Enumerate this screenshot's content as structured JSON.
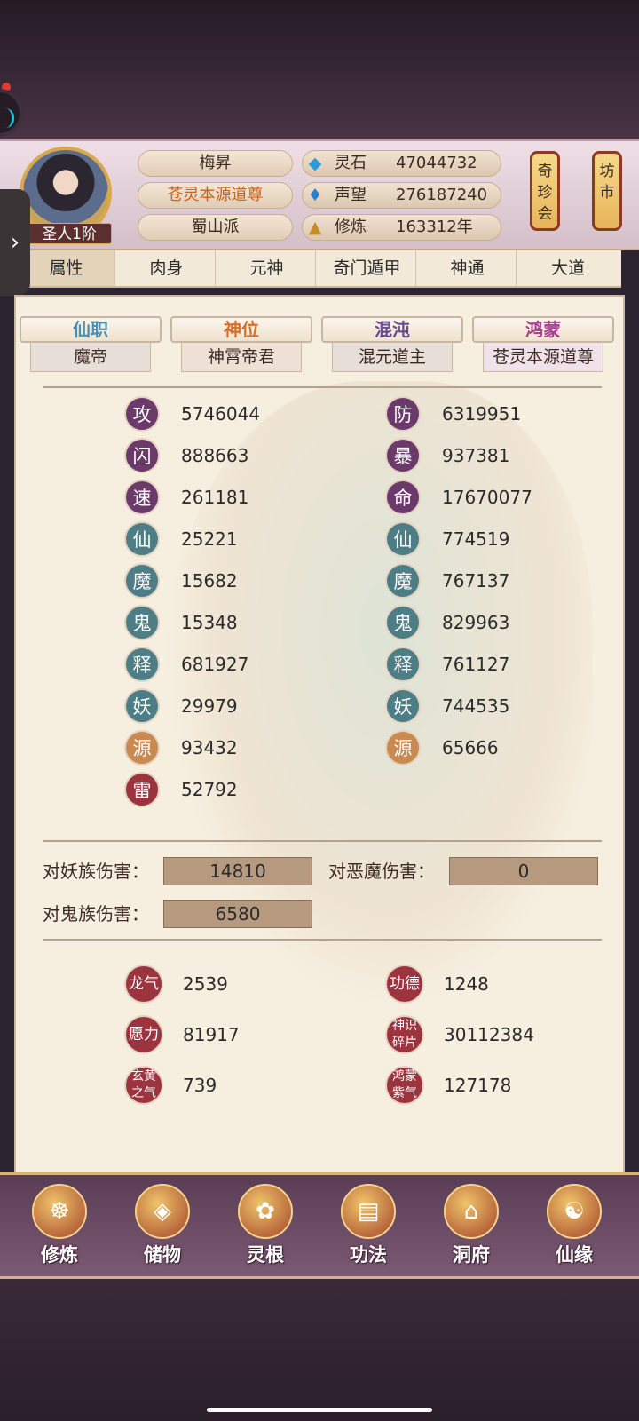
{
  "header": {
    "rank_badge": "圣人1阶",
    "name": "梅昇",
    "title": "苍灵本源道尊",
    "sect": "蜀山派",
    "resources": [
      {
        "icon": "spirit-stone-icon",
        "label": "灵石",
        "value": "47044732"
      },
      {
        "icon": "prestige-icon",
        "label": "声望",
        "value": "276187240"
      },
      {
        "icon": "cultivation-icon",
        "label": "修炼",
        "value": "163312年"
      }
    ],
    "lantern_left": "奇珍会",
    "lantern_right": "坊市"
  },
  "tabs": [
    "属性",
    "肉身",
    "元神",
    "奇门遁甲",
    "神通",
    "大道"
  ],
  "banners": [
    {
      "title": "仙职",
      "value": "魔帝",
      "color": "#4c8fb0"
    },
    {
      "title": "神位",
      "value": "神霄帝君",
      "color": "#d2702c"
    },
    {
      "title": "混沌",
      "value": "混元道主",
      "color": "#6a4a90"
    },
    {
      "title": "鸿蒙",
      "value": "苍灵本源道尊",
      "color": "#a53f90"
    }
  ],
  "stats_left": [
    {
      "glyph": "攻",
      "value": "5746044"
    },
    {
      "glyph": "闪",
      "value": "888663"
    },
    {
      "glyph": "速",
      "value": "261181"
    },
    {
      "glyph": "仙",
      "value": "25221"
    },
    {
      "glyph": "魔",
      "value": "15682"
    },
    {
      "glyph": "鬼",
      "value": "15348"
    },
    {
      "glyph": "释",
      "value": "681927"
    },
    {
      "glyph": "妖",
      "value": "29979"
    },
    {
      "glyph": "源",
      "value": "93432"
    },
    {
      "glyph": "雷",
      "value": "52792"
    }
  ],
  "stats_right": [
    {
      "glyph": "防",
      "value": "6319951"
    },
    {
      "glyph": "暴",
      "value": "937381"
    },
    {
      "glyph": "命",
      "value": "17670077"
    },
    {
      "glyph": "仙",
      "value": "774519"
    },
    {
      "glyph": "魔",
      "value": "767137"
    },
    {
      "glyph": "鬼",
      "value": "829963"
    },
    {
      "glyph": "释",
      "value": "761127"
    },
    {
      "glyph": "妖",
      "value": "744535"
    },
    {
      "glyph": "源",
      "value": "65666"
    }
  ],
  "damage": {
    "demon_race_label": "对妖族伤害：",
    "demon_race_value": "14810",
    "evil_demon_label": "对恶魔伤害：",
    "evil_demon_value": "0",
    "ghost_race_label": "对鬼族伤害：",
    "ghost_race_value": "6580"
  },
  "extras": [
    {
      "glyph": "龙气",
      "value": "2539"
    },
    {
      "glyph": "功德",
      "value": "1248"
    },
    {
      "glyph": "愿力",
      "value": "81917"
    },
    {
      "glyph": "神识碎片",
      "value": "30112384"
    },
    {
      "glyph": "玄黄之气",
      "value": "739"
    },
    {
      "glyph": "鸿蒙紫气",
      "value": "127178"
    }
  ],
  "bottom_nav": [
    {
      "label": "修炼",
      "icon": "cultivate-icon"
    },
    {
      "label": "储物",
      "icon": "storage-bag-icon"
    },
    {
      "label": "灵根",
      "icon": "spirit-root-icon"
    },
    {
      "label": "功法",
      "icon": "technique-book-icon"
    },
    {
      "label": "洞府",
      "icon": "cave-mansion-icon"
    },
    {
      "label": "仙缘",
      "icon": "immortal-fate-icon"
    }
  ]
}
